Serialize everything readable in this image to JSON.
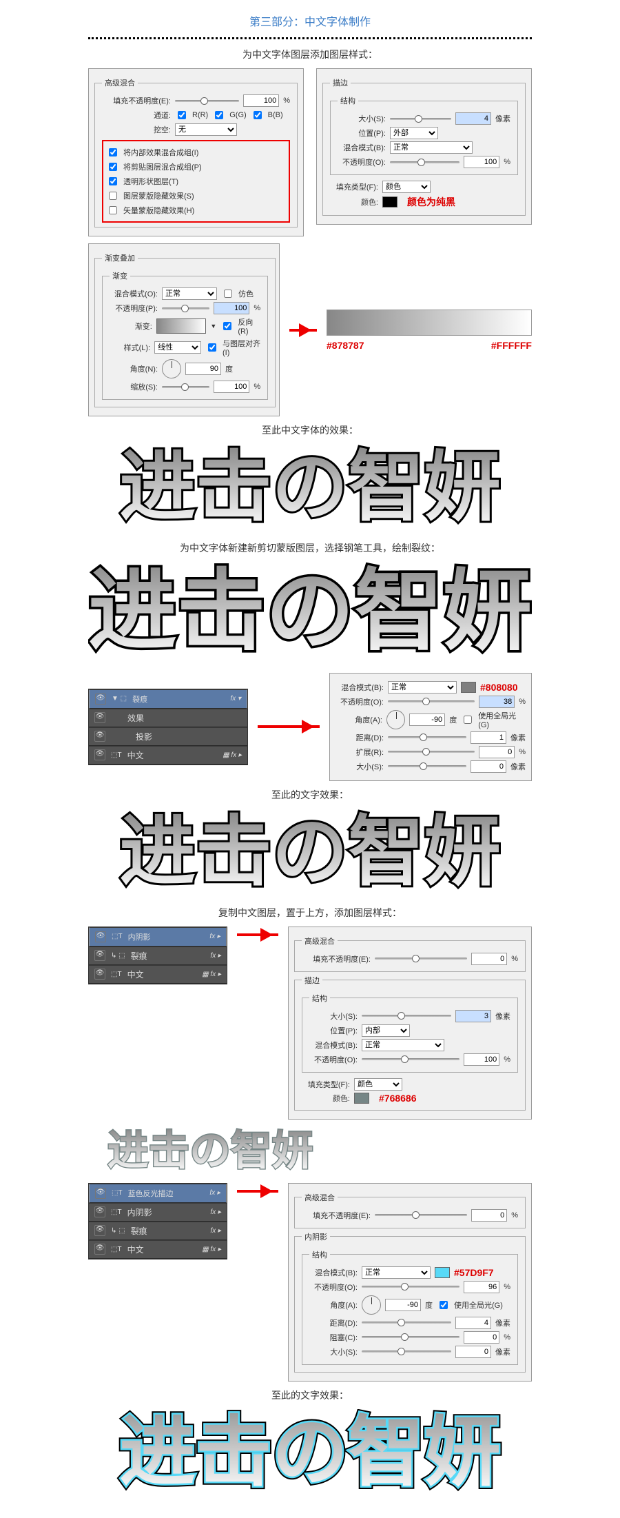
{
  "title": "第三部分：中文字体制作",
  "caption1": "为中文字体图层添加图层样式：",
  "advBlend": {
    "title": "高级混合",
    "fillOpacity": "填充不透明度(E):",
    "fillVal": "100",
    "pct": "%",
    "channels": "通道:",
    "r": "R(R)",
    "g": "G(G)",
    "b": "B(B)",
    "knockout": "挖空:",
    "knockoutVal": "无",
    "opt1": "将内部效果混合成组(I)",
    "opt2": "将剪贴图层混合成组(P)",
    "opt3": "透明形状图层(T)",
    "opt4": "图层蒙版隐藏效果(S)",
    "opt5": "矢量蒙版隐藏效果(H)"
  },
  "stroke": {
    "title": "描边",
    "struct": "结构",
    "size": "大小(S):",
    "sizeVal": "4",
    "px": "像素",
    "pos": "位置(P):",
    "posVal": "外部",
    "blend": "混合模式(B):",
    "blendVal": "正常",
    "opacity": "不透明度(O):",
    "opacityVal": "100",
    "fillType": "填充类型(F):",
    "fillTypeVal": "颜色",
    "color": "颜色:",
    "note": "颜色为纯黑"
  },
  "gov": {
    "title": "渐变叠加",
    "sub": "渐变",
    "blend": "混合模式(O):",
    "blendVal": "正常",
    "dither": "仿色",
    "opacity": "不透明度(P):",
    "opacityVal": "100",
    "gradient": "渐变:",
    "reverse": "反向(R)",
    "style": "样式(L):",
    "styleVal": "线性",
    "align": "与图层对齐(I)",
    "angle": "角度(N):",
    "angleVal": "90",
    "deg": "度",
    "scale": "缩放(S):",
    "scaleVal": "100",
    "pct": "%",
    "c1": "#878787",
    "c2": "#FFFFFF"
  },
  "caption2": "至此中文字体的效果：",
  "sampleText": "进击の智妍",
  "caption3": "为中文字体新建新剪切蒙版图层，选择钢笔工具，绘制裂纹：",
  "layers1": {
    "l1": "裂痕",
    "l2": "效果",
    "l3": "投影",
    "l4": "中文"
  },
  "shadow": {
    "blend": "混合模式(B):",
    "blendVal": "正常",
    "hex": "#808080",
    "opacity": "不透明度(O):",
    "opacityVal": "38",
    "angle": "角度(A):",
    "angleVal": "-90",
    "deg": "度",
    "global": "使用全局光(G)",
    "dist": "距离(D):",
    "distVal": "1",
    "px": "像素",
    "spread": "扩展(R):",
    "spreadVal": "0",
    "size": "大小(S):",
    "sizeVal": "0"
  },
  "caption4": "至此的文字效果：",
  "caption5": "复制中文图层，置于上方，添加图层样式：",
  "layers2": {
    "l1": "内阴影",
    "l2": "裂痕",
    "l3": "中文"
  },
  "adv2": {
    "title": "高级混合",
    "fill": "填充不透明度(E):",
    "fillVal": "0",
    "pct": "%"
  },
  "stroke2": {
    "title": "描边",
    "struct": "结构",
    "size": "大小(S):",
    "sizeVal": "3",
    "px": "像素",
    "pos": "位置(P):",
    "posVal": "内部",
    "blend": "混合模式(B):",
    "blendVal": "正常",
    "opacity": "不透明度(O):",
    "opacityVal": "100",
    "fillType": "填充类型(F):",
    "fillTypeVal": "颜色",
    "color": "颜色:",
    "hex": "#768686"
  },
  "layers3": {
    "l1": "蓝色反光描边",
    "l2": "内阴影",
    "l3": "裂痕",
    "l4": "中文"
  },
  "inner": {
    "title": "内阴影",
    "struct": "结构",
    "blend": "混合模式(B):",
    "blendVal": "正常",
    "hex": "#57D9F7",
    "opacity": "不透明度(O):",
    "opacityVal": "96",
    "angle": "角度(A):",
    "angleVal": "-90",
    "deg": "度",
    "global": "使用全局光(G)",
    "dist": "距离(D):",
    "distVal": "4",
    "px": "像素",
    "choke": "阻塞(C):",
    "chokeVal": "0",
    "size": "大小(S):",
    "sizeVal": "0"
  },
  "caption6": "至此的文字效果："
}
